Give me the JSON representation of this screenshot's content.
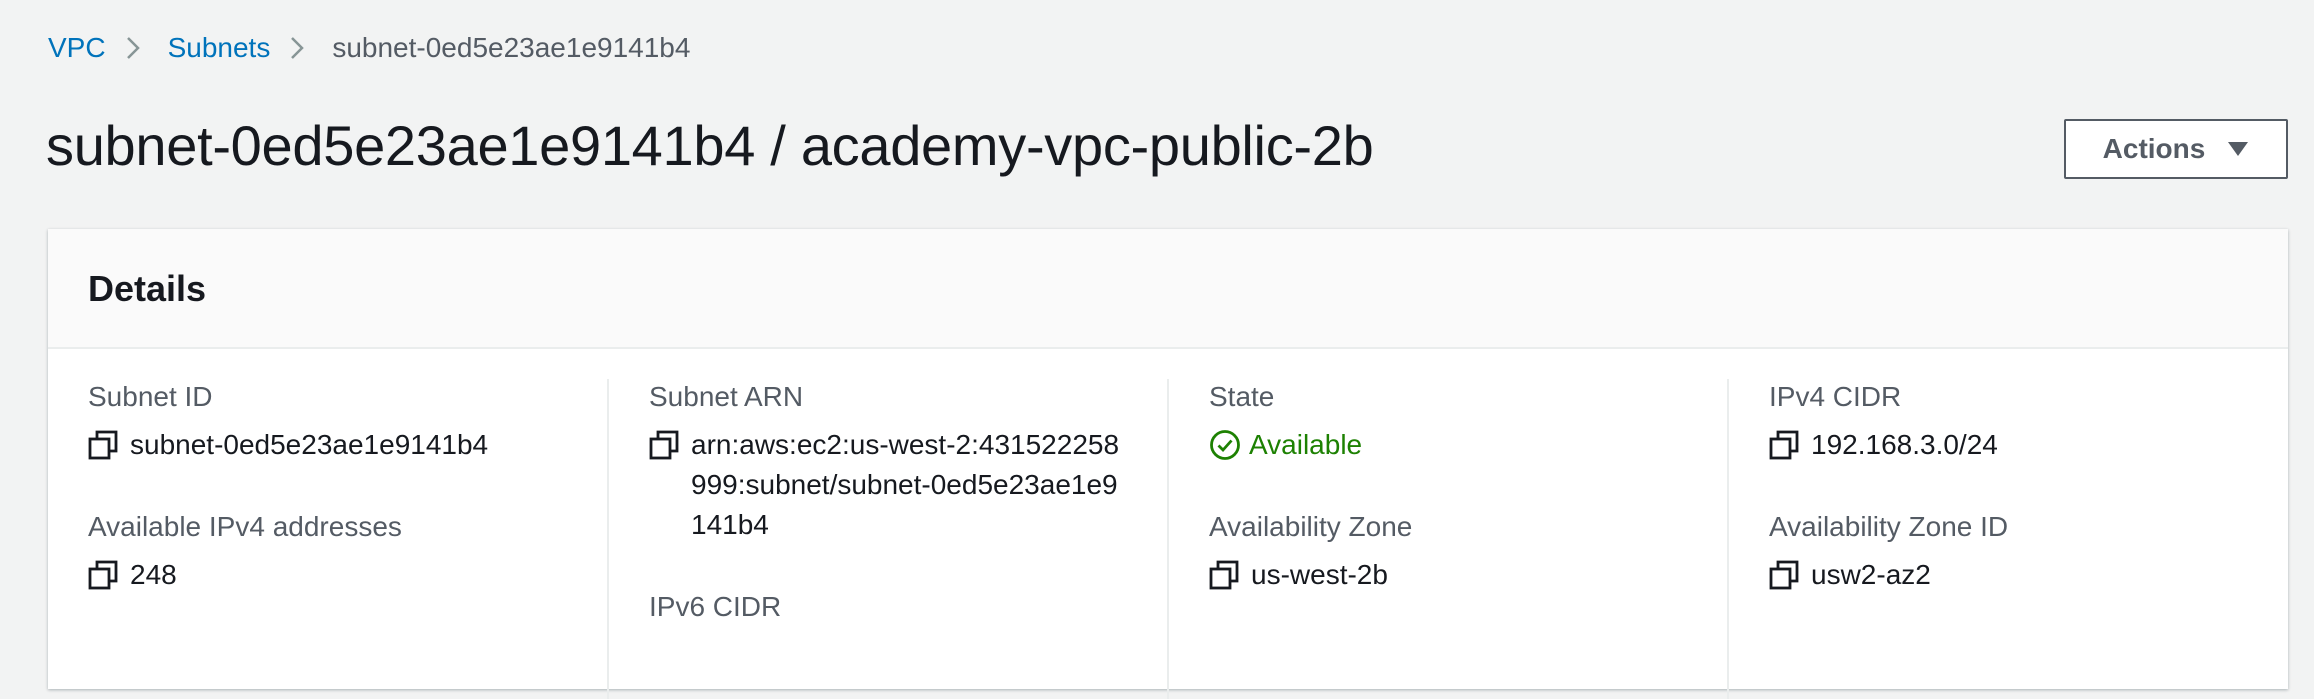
{
  "breadcrumb": {
    "items": [
      "VPC",
      "Subnets"
    ],
    "current": "subnet-0ed5e23ae1e9141b4"
  },
  "page": {
    "title": "subnet-0ed5e23ae1e9141b4 / academy-vpc-public-2b",
    "actions_label": "Actions"
  },
  "details": {
    "title": "Details",
    "subnet_id": {
      "label": "Subnet ID",
      "value": "subnet-0ed5e23ae1e9141b4"
    },
    "available_ipv4": {
      "label": "Available IPv4 addresses",
      "value": "248"
    },
    "subnet_arn": {
      "label": "Subnet ARN",
      "value": "arn:aws:ec2:us-west-2:431522258999:subnet/subnet-0ed5e23ae1e9141b4"
    },
    "ipv6_cidr": {
      "label": "IPv6 CIDR"
    },
    "state": {
      "label": "State",
      "value": "Available"
    },
    "availability_zone": {
      "label": "Availability Zone",
      "value": "us-west-2b"
    },
    "ipv4_cidr": {
      "label": "IPv4 CIDR",
      "value": "192.168.3.0/24"
    },
    "availability_zone_id": {
      "label": "Availability Zone ID",
      "value": "usw2-az2"
    }
  },
  "colors": {
    "link": "#0073bb",
    "status_success": "#1d8102",
    "text": "#16191f",
    "muted": "#545b64",
    "background": "#f2f3f3"
  },
  "icons": {
    "breadcrumb_separator": "chevron-right-icon",
    "actions_caret": "caret-down-icon",
    "copy": "copy-icon",
    "status": "check-circle-icon"
  }
}
